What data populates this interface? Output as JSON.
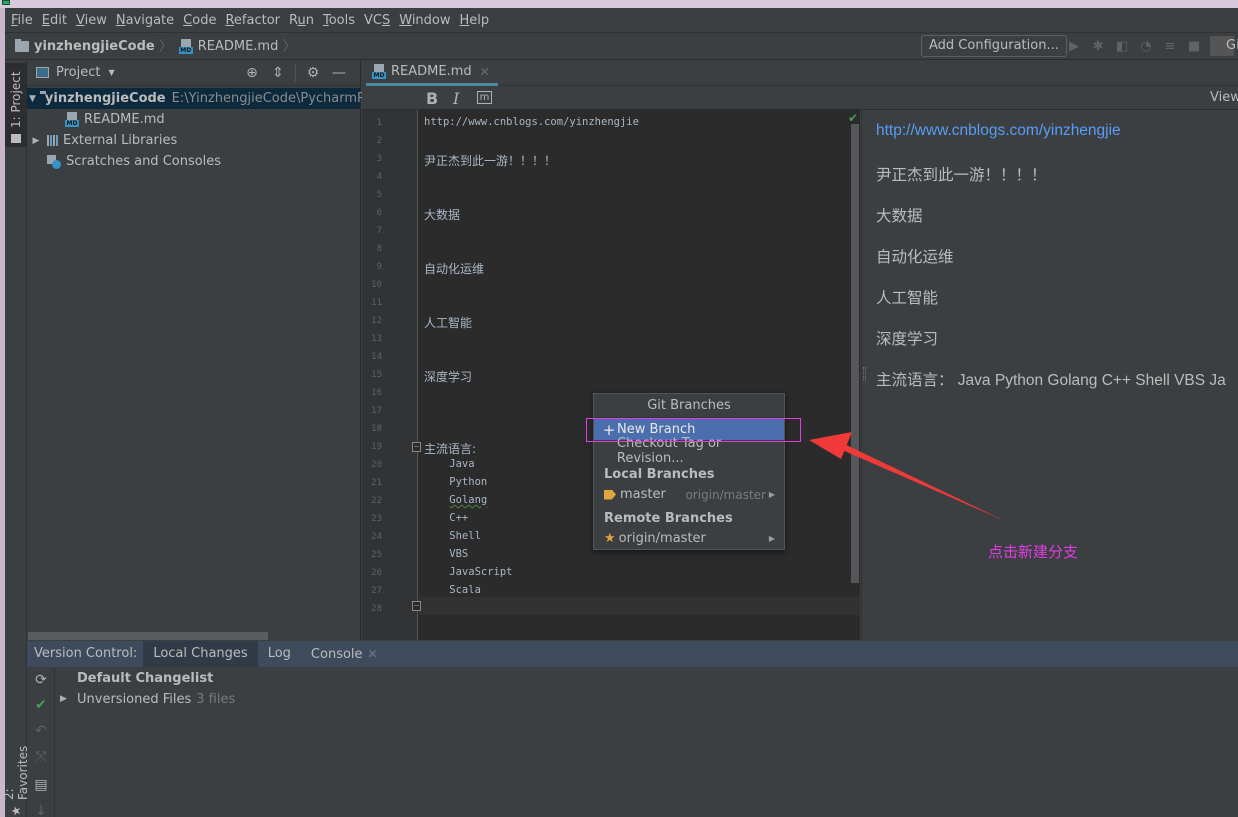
{
  "menu": {
    "items": [
      "File",
      "Edit",
      "View",
      "Navigate",
      "Code",
      "Refactor",
      "Run",
      "Tools",
      "VCS",
      "Window",
      "Help"
    ],
    "mnemonics": [
      "F",
      "E",
      "V",
      "N",
      "C",
      "R",
      "u",
      "T",
      "S",
      "W",
      "H"
    ]
  },
  "breadcrumb": {
    "project": "yinzhengjieCode",
    "file": "README.md",
    "file_icon_label": "MD"
  },
  "toolbar": {
    "add_configuration_label": "Add Configuration...",
    "icons": [
      "run-icon",
      "debug-icon",
      "coverage-icon",
      "profile-icon",
      "concurrency-icon",
      "stop-icon"
    ],
    "git_label": "Git"
  },
  "left_strip": {
    "project_tab": "1: Project",
    "favorites_tab": "2: Favorites"
  },
  "project_panel": {
    "title": "Project",
    "tree": [
      {
        "label": "yinzhengjieCode",
        "path": "E:\\YinzhengjieCode\\PycharmProj",
        "type": "folder",
        "expanded": true,
        "selected": true
      },
      {
        "label": "README.md",
        "type": "md-file"
      },
      {
        "label": "External Libraries",
        "type": "libraries",
        "expanded": false
      },
      {
        "label": "Scratches and Consoles",
        "type": "scratches"
      }
    ]
  },
  "editor": {
    "tab_label": "README.md",
    "format_buttons": {
      "bold": "B",
      "italic": "I",
      "mono": "m"
    },
    "view_label": "View",
    "lines": [
      {
        "n": "1",
        "text": "http://www.cnblogs.com/yinzhengjie"
      },
      {
        "n": "2",
        "text": ""
      },
      {
        "n": "3",
        "text": "尹正杰到此一游！！！！"
      },
      {
        "n": "4",
        "text": ""
      },
      {
        "n": "5",
        "text": ""
      },
      {
        "n": "6",
        "text": "大数据"
      },
      {
        "n": "7",
        "text": ""
      },
      {
        "n": "8",
        "text": ""
      },
      {
        "n": "9",
        "text": "自动化运维"
      },
      {
        "n": "10",
        "text": ""
      },
      {
        "n": "11",
        "text": ""
      },
      {
        "n": "12",
        "text": "人工智能"
      },
      {
        "n": "13",
        "text": ""
      },
      {
        "n": "14",
        "text": ""
      },
      {
        "n": "15",
        "text": "深度学习"
      },
      {
        "n": "16",
        "text": ""
      },
      {
        "n": "17",
        "text": ""
      },
      {
        "n": "18",
        "text": ""
      },
      {
        "n": "19",
        "text": "主流语言:"
      },
      {
        "n": "20",
        "text": "    Java"
      },
      {
        "n": "21",
        "text": "    Python"
      },
      {
        "n": "22",
        "text": "    Golang"
      },
      {
        "n": "23",
        "text": "    C++"
      },
      {
        "n": "24",
        "text": "    Shell"
      },
      {
        "n": "25",
        "text": "    VBS"
      },
      {
        "n": "26",
        "text": "    JavaScript"
      },
      {
        "n": "27",
        "text": "    Scala"
      },
      {
        "n": "28",
        "text": ""
      }
    ]
  },
  "preview": {
    "link": "http://www.cnblogs.com/yinzhengjie",
    "paragraphs": [
      "尹正杰到此一游！！！！",
      "大数据",
      "自动化运维",
      "人工智能",
      "深度学习",
      "主流语言：  Java Python Golang C++ Shell VBS Ja"
    ]
  },
  "git_popup": {
    "title": "Git Branches",
    "new_branch": "New Branch",
    "checkout": "Checkout Tag or Revision...",
    "local_header": "Local Branches",
    "local_branches": [
      {
        "name": "master",
        "tracking": "origin/master"
      }
    ],
    "remote_header": "Remote Branches",
    "remote_branches": [
      {
        "name": "origin/master"
      }
    ]
  },
  "annotation": {
    "text": "点击新建分支",
    "color": "#e23ce3",
    "arrow_color": "#f03a3a"
  },
  "version_control": {
    "label": "Version Control:",
    "tabs": [
      "Local Changes",
      "Log",
      "Console"
    ],
    "active_tab": "Local Changes",
    "changelist": "Default Changelist",
    "unversioned_label": "Unversioned Files",
    "unversioned_count": "3 files"
  }
}
